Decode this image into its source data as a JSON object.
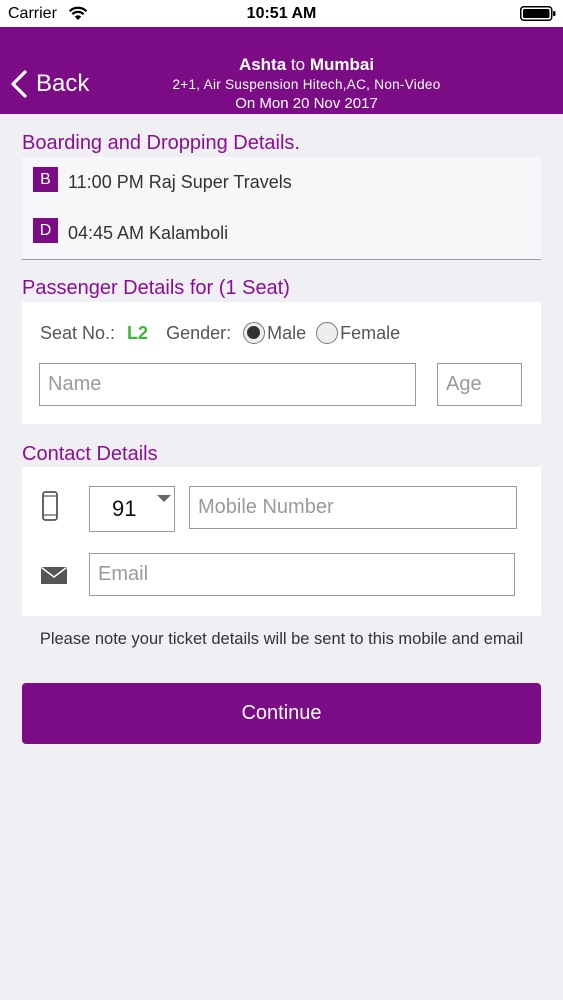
{
  "status_bar": {
    "carrier": "Carrier",
    "time": "10:51 AM"
  },
  "nav": {
    "back_label": "Back",
    "route_from": "Ashta",
    "route_to_word": "to",
    "route_to": "Mumbai",
    "bus_type": "2+1, Air Suspension Hitech,AC, Non-Video",
    "date": "On Mon 20 Nov 2017"
  },
  "boarding": {
    "section_title": "Boarding and Dropping Details.",
    "boarding_badge": "B",
    "boarding_text": "11:00 PM Raj Super Travels",
    "dropping_badge": "D",
    "dropping_text": "04:45 AM Kalamboli"
  },
  "passenger": {
    "section_title": "Passenger Details for (1 Seat)",
    "seat_label": "Seat No.:",
    "seat_value": "L2",
    "gender_label": "Gender:",
    "gender_options": [
      "Male",
      "Female"
    ],
    "gender_selected": "Male",
    "name_placeholder": "Name",
    "age_placeholder": "Age"
  },
  "contact": {
    "section_title": "Contact Details",
    "country_code": "91",
    "mobile_placeholder": "Mobile Number",
    "email_placeholder": "Email"
  },
  "note": "Please note your ticket details will be sent to this mobile and email",
  "continue_label": "Continue",
  "colors": {
    "brand": "#7b0c86",
    "section_title": "#8b0e96",
    "seat_value": "#3bb93b",
    "background": "#efeff4"
  },
  "icons": {
    "wifi": "wifi-icon",
    "battery": "battery-icon",
    "back": "chevron-left-icon",
    "phone": "mobile-phone-icon",
    "mail": "mail-icon",
    "dropdown": "caret-down-icon"
  }
}
